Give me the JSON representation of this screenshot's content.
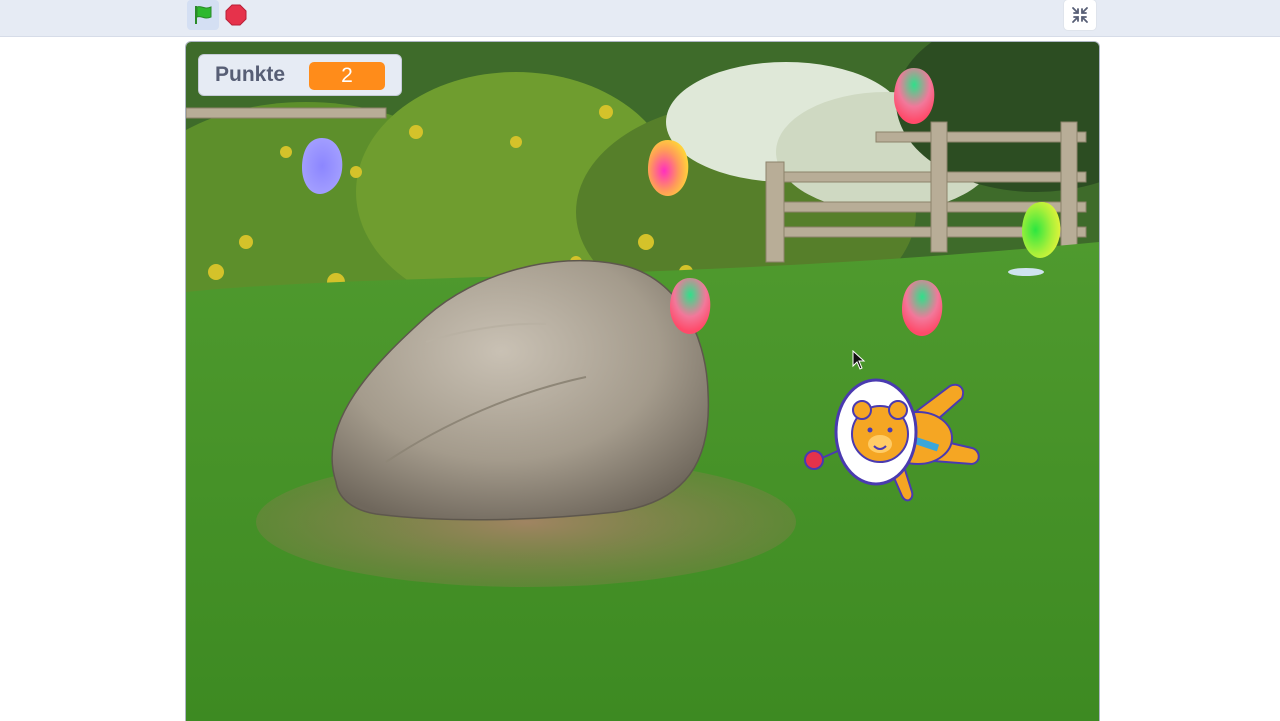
{
  "toolbar": {
    "green_flag_icon": "green-flag-icon",
    "stop_icon": "stop-sign-icon",
    "unfullscreen_icon": "collapse-icon"
  },
  "stage": {
    "backdrop": "garden-rock-backdrop",
    "score_monitor": {
      "label": "Punkte",
      "value": "2"
    },
    "sprites": [
      "balloon",
      "balloon",
      "balloon",
      "balloon",
      "balloon",
      "balloon",
      "space-bear"
    ]
  },
  "colors": {
    "monitor_value": "#ff8c1a",
    "flag": "#2eb82e",
    "stop": "#e6324b"
  }
}
